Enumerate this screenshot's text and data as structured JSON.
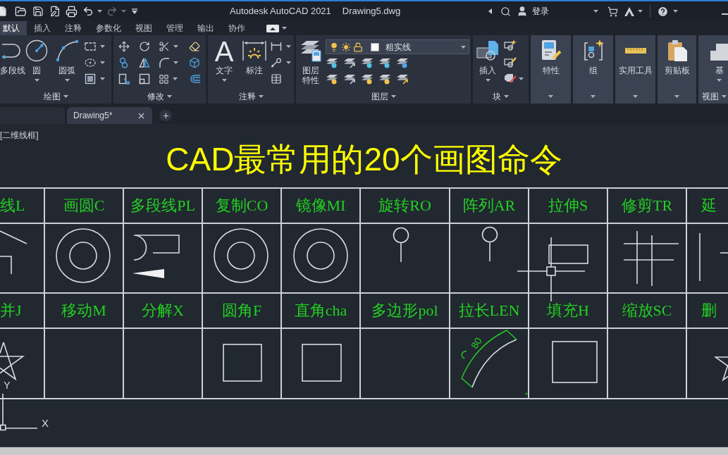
{
  "title_bar": {
    "app_title": "Autodesk AutoCAD 2021",
    "file_name": "Drawing5.dwg",
    "sign_in": "登录"
  },
  "ribbon_tabs": [
    {
      "label": "默认",
      "selected": true
    },
    {
      "label": "插入",
      "selected": false
    },
    {
      "label": "注释",
      "selected": false
    },
    {
      "label": "参数化",
      "selected": false
    },
    {
      "label": "视图",
      "selected": false
    },
    {
      "label": "管理",
      "selected": false
    },
    {
      "label": "输出",
      "selected": false
    },
    {
      "label": "协作",
      "selected": false
    }
  ],
  "ribbon_panels": [
    {
      "title": "绘图",
      "buttons": [
        "多段线",
        "圆",
        "圆弧"
      ]
    },
    {
      "title": "修改"
    },
    {
      "title": "注释",
      "glyph": "A",
      "buttons": [
        "文字",
        "标注"
      ]
    },
    {
      "title": "图层",
      "buttons": [
        "图层特性"
      ],
      "layer": "粗实线"
    },
    {
      "title": "块",
      "buttons": [
        "插入"
      ]
    },
    {
      "buttons": [
        "特性"
      ]
    },
    {
      "buttons": [
        "组"
      ]
    },
    {
      "buttons": [
        "实用工具"
      ]
    },
    {
      "buttons": [
        "剪贴板"
      ]
    },
    {
      "title": "视图",
      "buttons": [
        "基"
      ]
    }
  ],
  "file_tabs": [
    {
      "selected": false
    },
    {
      "label": "Drawing5*",
      "selected": true
    }
  ],
  "viewport_label": "[二维线框]",
  "drawing": {
    "title": "CAD最常用的20个画图命令",
    "label_rows": [
      [
        "线L",
        "画圆C",
        "多段线PL",
        "复制CO",
        "镜像MI",
        "旋转RO",
        "阵列AR",
        "拉伸S",
        "修剪TR",
        "延"
      ],
      [
        "并J",
        "移动M",
        "分解X",
        "圆角F",
        "直角cha",
        "多边形pol",
        "拉长LEN",
        "填充H",
        "缩放SC",
        "删"
      ]
    ],
    "dimension_text": "80",
    "ucs": {
      "x_label": "X",
      "y_label": "Y"
    }
  }
}
